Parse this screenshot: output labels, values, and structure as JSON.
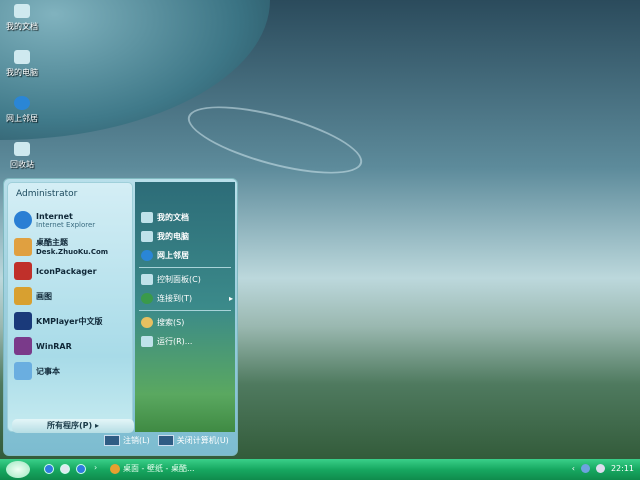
{
  "desktop_icons": [
    {
      "label": "我的文档"
    },
    {
      "label": "我的电脑"
    },
    {
      "label": "网上邻居"
    },
    {
      "label": "回收站"
    }
  ],
  "start_menu": {
    "user": "Administrator",
    "pinned": [
      {
        "title": "Internet",
        "subtitle": "Internet Explorer",
        "color": "#2a7fd4"
      },
      {
        "title": "桌酷主题",
        "subtitle": "Desk.ZhuoKu.Com",
        "color": "#e0a040"
      },
      {
        "title": "IconPackager",
        "color": "#c0302a"
      },
      {
        "title": "画图",
        "color": "#d8a030"
      },
      {
        "title": "KMPlayer中文版",
        "color": "#1a3a7a"
      },
      {
        "title": "WinRAR",
        "color": "#7a3a8a"
      },
      {
        "title": "记事本",
        "color": "#6aaee0"
      }
    ],
    "all_programs": "所有程序(P)",
    "right": [
      {
        "label": "我的文档"
      },
      {
        "label": "我的电脑"
      },
      {
        "label": "网上邻居"
      },
      {
        "label": "控制面板(C)"
      },
      {
        "label": "连接到(T)"
      },
      {
        "label": "搜索(S)"
      },
      {
        "label": "运行(R)..."
      }
    ],
    "logoff": "注销(L)",
    "shutdown": "关闭计算机(U)"
  },
  "taskbar": {
    "task": "桌面 - 壁纸 - 桌酷...",
    "clock": "22:11"
  }
}
